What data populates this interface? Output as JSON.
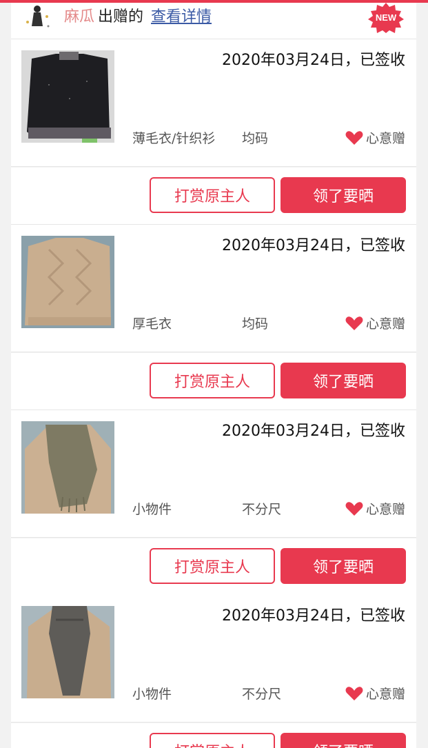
{
  "header": {
    "giver_name": "麻瓜",
    "action_text": "出赠的",
    "details_link": "查看详情",
    "badge": "NEW"
  },
  "items": [
    {
      "date": "2020年03月24日，已签收",
      "category": "薄毛衣/针织衫",
      "size": "均码",
      "tag": "心意赠",
      "reward_button": "打赏原主人",
      "share_button": "领了要晒",
      "thumb": "dark-sweater"
    },
    {
      "date": "2020年03月24日，已签收",
      "category": "厚毛衣",
      "size": "均码",
      "tag": "心意赠",
      "reward_button": "打赏原主人",
      "share_button": "领了要晒",
      "thumb": "beige-sweater"
    },
    {
      "date": "2020年03月24日，已签收",
      "category": "小物件",
      "size": "不分尺",
      "tag": "心意赠",
      "reward_button": "打赏原主人",
      "share_button": "领了要晒",
      "thumb": "scarf-on-sweater"
    },
    {
      "date": "2020年03月24日，已签收",
      "category": "小物件",
      "size": "不分尺",
      "tag": "心意赠",
      "reward_button": "打赏原主人",
      "share_button": "领了要晒",
      "thumb": "grey-scarf"
    }
  ],
  "colors": {
    "accent": "#e8394f",
    "link": "#3b5aa5",
    "name": "#e48a8a"
  },
  "icons": {
    "tag_icon": "heart-icon"
  }
}
